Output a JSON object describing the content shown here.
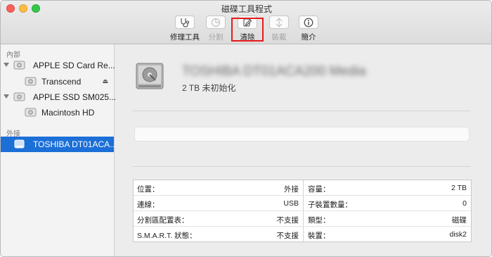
{
  "window": {
    "title": "磁碟工具程式"
  },
  "toolbar": {
    "first_aid": {
      "label": "修理工具",
      "icon": "stethoscope-icon"
    },
    "partition": {
      "label": "分割",
      "icon": "pie-partition-icon"
    },
    "erase": {
      "label": "清除",
      "icon": "erase-disk-icon"
    },
    "mount": {
      "label": "裝載",
      "icon": "mount-icon"
    },
    "info": {
      "label": "簡介",
      "icon": "info-icon"
    },
    "highlight_color": "#e8191b"
  },
  "sidebar": {
    "internal_header": "內部",
    "external_header": "外接",
    "items": [
      {
        "label": "APPLE SD Card Re..."
      },
      {
        "label": "Transcend"
      },
      {
        "label": "APPLE SSD SM025..."
      },
      {
        "label": "Macintosh HD"
      },
      {
        "label": "TOSHIBA DT01ACA..."
      }
    ],
    "selected_color": "#1b6fd7"
  },
  "main": {
    "drive_name": "TOSHIBA DT01ACA200 Media",
    "drive_subtitle": "2 TB 未初始化"
  },
  "info": {
    "left": [
      {
        "key": "位置：",
        "value": "外接"
      },
      {
        "key": "連線：",
        "value": "USB"
      },
      {
        "key": "分割區配置表：",
        "value": "不支援"
      },
      {
        "key": "S.M.A.R.T. 狀態：",
        "value": "不支援"
      }
    ],
    "right": [
      {
        "key": "容量：",
        "value": "2 TB"
      },
      {
        "key": "子裝置數量：",
        "value": "0"
      },
      {
        "key": "類型：",
        "value": "磁碟"
      },
      {
        "key": "裝置：",
        "value": "disk2"
      }
    ]
  }
}
